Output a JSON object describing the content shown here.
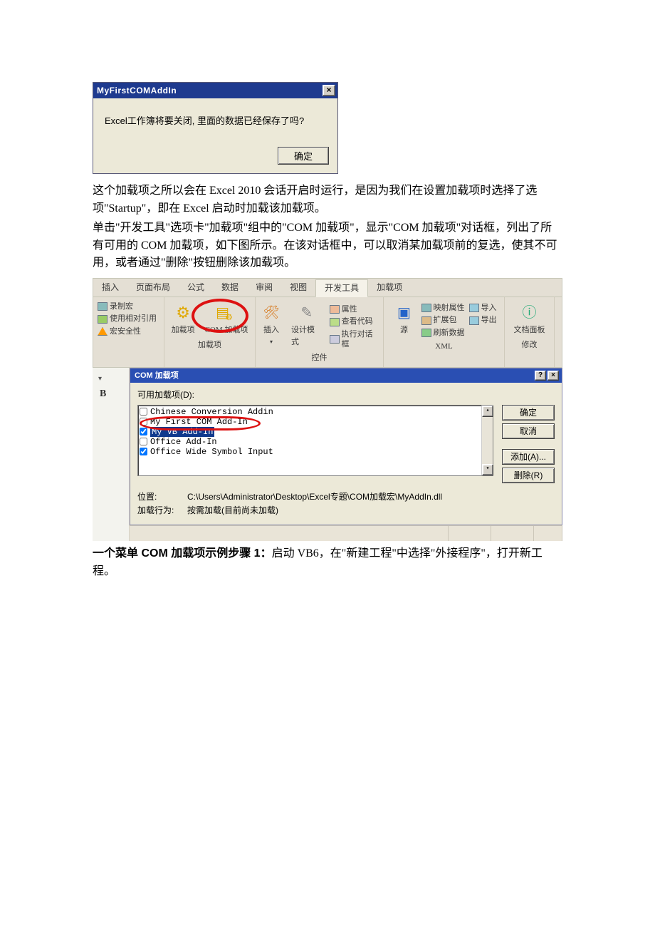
{
  "alert": {
    "title": "MyFirstCOMAddIn",
    "close_glyph": "×",
    "message": "Excel工作簿将要关闭, 里面的数据已经保存了吗?",
    "ok_label": "确定"
  },
  "body_text": {
    "p1": "这个加载项之所以会在 Excel 2010 会话开启时运行，是因为我们在设置加载项时选择了选项\"Startup\"，即在 Excel 启动时加载该加载项。",
    "p2": "单击\"开发工具\"选项卡\"加载项\"组中的\"COM 加载项\"，显示\"COM 加载项\"对话框，列出了所有可用的 COM 加载项，如下图所示。在该对话框中，可以取消某加载项前的复选，使其不可用，或者通过\"删除\"按钮删除该加载项。",
    "p3_bold": "一个菜单 COM 加载项示例步骤 1：",
    "p3_rest": "启动 VB6，在\"新建工程\"中选择\"外接程序\"，打开新工程。"
  },
  "ribbon": {
    "tabs": [
      "插入",
      "页面布局",
      "公式",
      "数据",
      "审阅",
      "视图",
      "开发工具",
      "加载项"
    ],
    "active_tab_index": 6,
    "group1": {
      "lines": [
        "录制宏",
        "使用相对引用",
        "宏安全性"
      ]
    },
    "group2": {
      "btn1": "加载项",
      "btn2": "COM 加载项",
      "label": "加载项"
    },
    "group3": {
      "btn1": "插入",
      "btn2": "设计模式",
      "lines": [
        "属性",
        "查看代码",
        "执行对话框"
      ],
      "label": "控件"
    },
    "group4": {
      "btn1": "源",
      "lines": [
        "映射属性",
        "扩展包",
        "刷新数据",
        "导入",
        "导出"
      ],
      "label": "XML"
    },
    "group5": {
      "btn1": "文档面板",
      "label": "修改"
    }
  },
  "comdialog": {
    "title": "COM 加载项",
    "help_glyph": "?",
    "close_glyph": "×",
    "available_label": "可用加载项(D):",
    "items": [
      {
        "checked": false,
        "label": "Chinese Conversion Addin"
      },
      {
        "checked": false,
        "label": "My First COM  Add-In"
      },
      {
        "checked": true,
        "label": "My VB Add-In",
        "highlight": true
      },
      {
        "checked": false,
        "label": "Office Add-In"
      },
      {
        "checked": true,
        "label": "Office Wide Symbol Input"
      }
    ],
    "buttons": {
      "ok": "确定",
      "cancel": "取消",
      "add": "添加(A)...",
      "remove": "删除(R)"
    },
    "location_label": "位置:",
    "location_value": "C:\\Users\\Administrator\\Desktop\\Excel专题\\COM加载宏\\MyAddIn.dll",
    "behavior_label": "加载行为:",
    "behavior_value": "按需加载(目前尚未加载)"
  },
  "leftgutter": {
    "B": "B"
  }
}
